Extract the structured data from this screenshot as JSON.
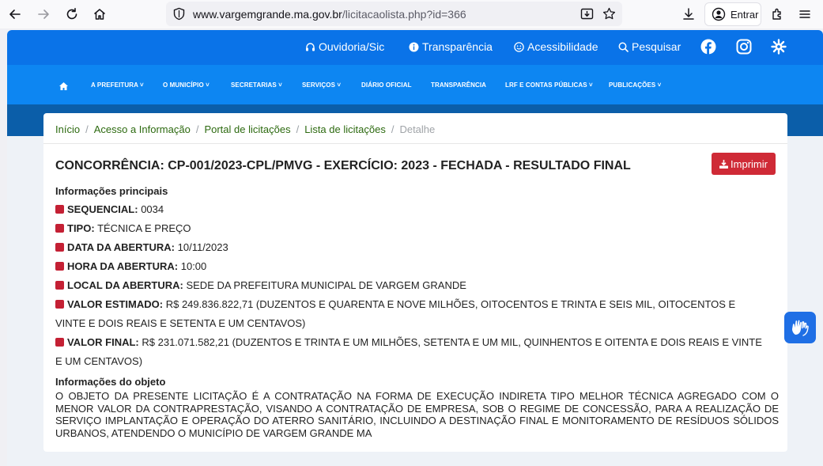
{
  "browser": {
    "url_domain": "www.vargemgrande.ma.gov.br",
    "url_path": "/licitacaolista.php?id=366",
    "signin_label": "Entrar"
  },
  "topbar": {
    "ouvidoria": "Ouvidoria/Sic",
    "transparencia": "Transparência",
    "acessibilidade": "Acessibilidade",
    "pesquisar": "Pesquisar"
  },
  "menu": {
    "items": [
      "A PREFEITURA",
      "O MUNICÍPIO",
      "SECRETARIAS",
      "SERVIÇOS",
      "DIÁRIO OFICIAL",
      "TRANSPARÊNCIA",
      "LRF E CONTAS PÚBLICAS",
      "PUBLICAÇÕES"
    ]
  },
  "breadcrumb": {
    "items": [
      "Início",
      "Acesso a Informação",
      "Portal de licitações",
      "Lista de licitações"
    ],
    "active": "Detalhe"
  },
  "detail": {
    "title": "CONCORRÊNCIA: CP-001/2023-CPL/PMVG - EXERCÍCIO: 2023 - FECHADA - RESULTADO FINAL",
    "print_label": "Imprimir",
    "main_info_heading": "Informações principais",
    "fields": [
      {
        "label": "SEQUENCIAL:",
        "value": "0034"
      },
      {
        "label": "TIPO:",
        "value": "TÉCNICA E PREÇO"
      },
      {
        "label": "DATA DA ABERTURA:",
        "value": "10/11/2023"
      },
      {
        "label": "HORA DA ABERTURA:",
        "value": "10:00"
      },
      {
        "label": "LOCAL DA ABERTURA:",
        "value": "SEDE DA PREFEITURA MUNICIPAL DE VARGEM GRANDE"
      },
      {
        "label": "VALOR ESTIMADO:",
        "value": "R$ 249.836.822,71 (DUZENTOS E QUARENTA E NOVE MILHÕES, OITOCENTOS E TRINTA E SEIS MIL, OITOCENTOS E VINTE E DOIS REAIS E SETENTA E UM CENTAVOS)"
      },
      {
        "label": "VALOR FINAL:",
        "value": "R$ 231.071.582,21 (DUZENTOS E TRINTA E UM MILHÕES, SETENTA E UM MIL, QUINHENTOS E OITENTA E DOIS REAIS E VINTE E UM CENTAVOS)"
      }
    ],
    "object_heading": "Informações do objeto",
    "object_text": "O OBJETO DA PRESENTE LICITAÇÃO É A CONTRATAÇÃO NA FORMA DE EXECUÇÃO INDIRETA TIPO MELHOR TÉCNICA AGREGADO COM O MENOR VALOR DA CONTRAPRESTAÇÃO, VISANDO A CONTRATAÇÃO DE EMPRESA, SOB O REGIME DE CONCESSÃO, PARA A REALIZAÇÃO DE SERVIÇO IMPLANTAÇÃO E OPERAÇÃO DO ATERRO SANITÁRIO, INCLUINDO A DESTINAÇÃO FINAL E MONITORAMENTO DE RESÍDUOS SÓLIDOS URBANOS, ATENDENDO O MUNICÍPIO DE VARGEM GRANDE  MA"
  },
  "colors": {
    "topbar": "#0a73e8",
    "menubar": "#0d86f2",
    "band": "#0b5ea9",
    "accent_red": "#cf2a36",
    "link_green": "#2d6a10"
  }
}
